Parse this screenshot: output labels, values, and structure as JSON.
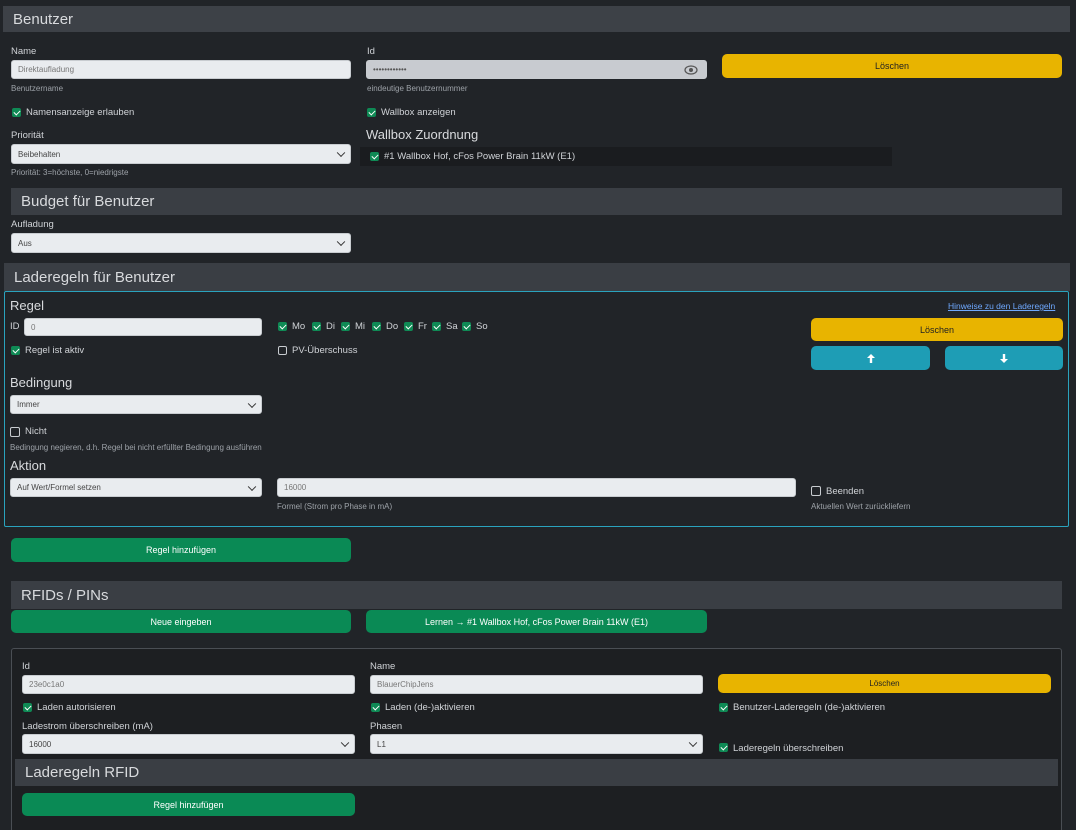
{
  "benutzer": {
    "title": "Benutzer",
    "name_label": "Name",
    "name_value": "Direktaufladung",
    "name_hint": "Benutzername",
    "id_label": "Id",
    "id_value": "••••••••••••",
    "id_hint": "eindeutige Benutzernummer",
    "delete_label": "Löschen",
    "allow_name_label": "Namensanzeige erlauben",
    "show_wallbox_label": "Wallbox anzeigen",
    "priority_label": "Priorität",
    "priority_value": "Beibehalten",
    "priority_hint": "Priorität: 3=höchste, 0=niedrigste",
    "wallbox_assign_title": "Wallbox Zuordnung",
    "wallbox_item": "#1 Wallbox Hof, cFos Power Brain 11kW (E1)"
  },
  "budget": {
    "title": "Budget für Benutzer",
    "charging_label": "Aufladung",
    "charging_value": "Aus"
  },
  "laderegeln": {
    "title": "Laderegeln für Benutzer",
    "rule_title": "Regel",
    "hints_link": "Hinweise zu den Laderegeln",
    "id_label": "ID",
    "id_value": "0",
    "days": [
      "Mo",
      "Di",
      "Mi",
      "Do",
      "Fr",
      "Sa",
      "So"
    ],
    "delete_label": "Löschen",
    "active_label": "Regel ist aktiv",
    "pv_label": "PV-Überschuss",
    "condition_title": "Bedingung",
    "condition_value": "Immer",
    "not_label": "Nicht",
    "not_hint": "Bedingung negieren, d.h. Regel bei nicht erfüllter Bedingung ausführen",
    "action_title": "Aktion",
    "action_value": "Auf Wert/Formel setzen",
    "formula_value": "16000",
    "formula_hint": "Formel (Strom pro Phase in mA)",
    "end_label": "Beenden",
    "end_hint": "Aktuellen Wert zurückliefern",
    "add_rule_label": "Regel hinzufügen"
  },
  "rfid": {
    "title": "RFIDs / PINs",
    "new_label": "Neue eingeben",
    "learn_label": "Lernen → #1 Wallbox Hof, cFos Power Brain 11kW (E1)",
    "id_label": "Id",
    "id_value": "23e0c1a0",
    "name_label": "Name",
    "name_value": "BlauerChipJens",
    "delete_label": "Löschen",
    "auth_label": "Laden autorisieren",
    "toggle_label": "Laden (de-)aktivieren",
    "user_rules_label": "Benutzer-Laderegeln (de-)aktivieren",
    "current_label": "Ladestrom überschreiben (mA)",
    "current_value": "16000",
    "phases_label": "Phasen",
    "phases_value": "L1",
    "override_label": "Laderegeln überschreiben",
    "rfid_rules_title": "Laderegeln RFID",
    "add_rule_label": "Regel hinzufügen"
  },
  "colors": {
    "accent_yellow": "#e8b400",
    "accent_green": "#0a8a55",
    "accent_teal": "#1e9db5",
    "background": "#212428",
    "section_header": "#3a3e44"
  }
}
